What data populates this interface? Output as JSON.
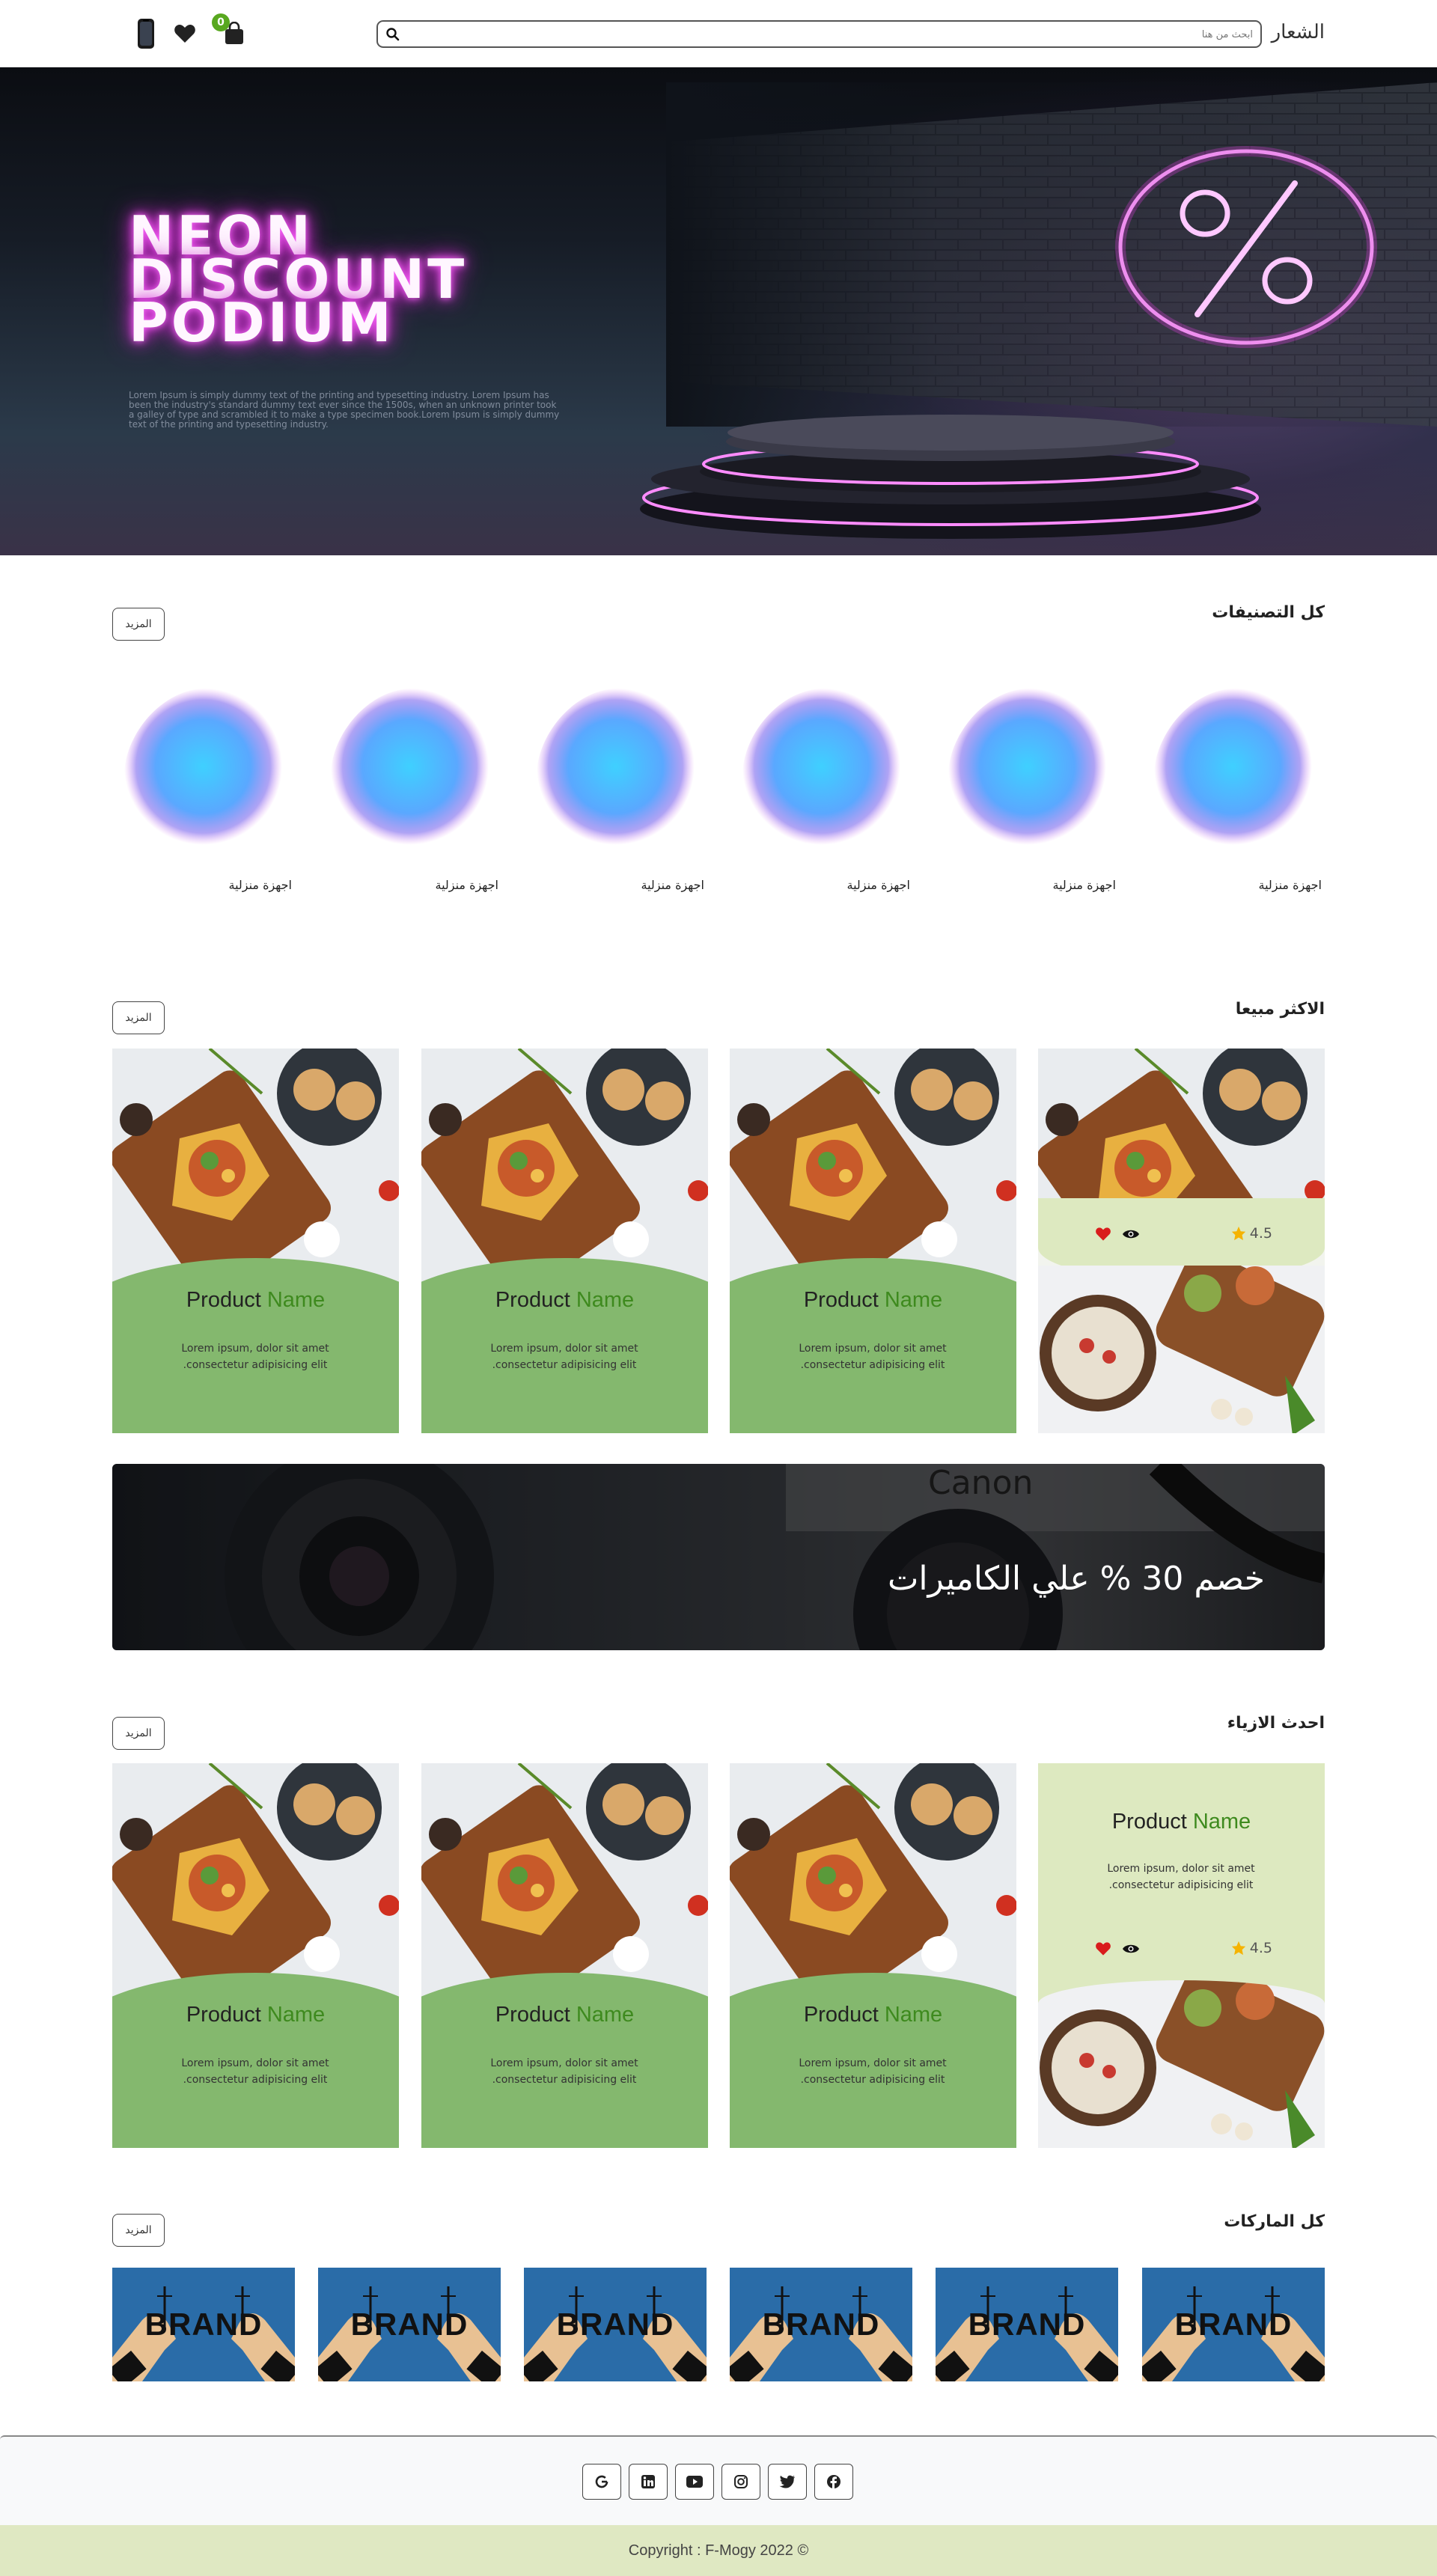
{
  "navbar": {
    "brand": "الشعار",
    "search_placeholder": "ابحث من هنا",
    "cart_count": "0"
  },
  "hero": {
    "title": "NEON\nDISCOUNT\nPODIUM",
    "subtitle": "Lorem Ipsum is simply dummy text of the printing and typesetting industry. Lorem Ipsum has been the industry's standard dummy text ever since the 1500s, when an unknown printer took a galley of type and scrambled it to make a type specimen book.Lorem Ipsum is simply dummy text of the printing and typesetting industry."
  },
  "categories": {
    "title": "كل التصنيفات",
    "more": "المزيد",
    "items": [
      {
        "label": "اجهزة منزلية"
      },
      {
        "label": "اجهزة منزلية"
      },
      {
        "label": "اجهزة منزلية"
      },
      {
        "label": "اجهزة منزلية"
      },
      {
        "label": "اجهزة منزلية"
      },
      {
        "label": "اجهزة منزلية"
      }
    ]
  },
  "bestsellers": {
    "title": "الاكثر مبيعا",
    "more": "المزيد",
    "hover_rating": "4.5",
    "cards": [
      {
        "name_a": "Product",
        "name_b": "Name",
        "desc": "Lorem ipsum, dolor sit amet consectetur adipisicing elit."
      },
      {
        "name_a": "Product",
        "name_b": "Name",
        "desc": "Lorem ipsum, dolor sit amet consectetur adipisicing elit."
      },
      {
        "name_a": "Product",
        "name_b": "Name",
        "desc": "Lorem ipsum, dolor sit amet consectetur adipisicing elit."
      }
    ]
  },
  "promo": {
    "text": "خصم 30 % علي الكاميرات"
  },
  "fashion": {
    "title": "احدث الازياء",
    "more": "المزيد",
    "hover_name_a": "Product",
    "hover_name_b": "Name",
    "hover_desc": "Lorem ipsum, dolor sit amet consectetur adipisicing elit.",
    "hover_rating": "4.5",
    "cards": [
      {
        "name_a": "Product",
        "name_b": "Name",
        "desc": "Lorem ipsum, dolor sit amet consectetur adipisicing elit."
      },
      {
        "name_a": "Product",
        "name_b": "Name",
        "desc": "Lorem ipsum, dolor sit amet consectetur adipisicing elit."
      },
      {
        "name_a": "Product",
        "name_b": "Name",
        "desc": "Lorem ipsum, dolor sit amet consectetur adipisicing elit."
      }
    ]
  },
  "brands": {
    "title": "كل الماركات",
    "more": "المزيد",
    "logo_text": "BRAND"
  },
  "footer": {
    "socials": [
      "google-icon",
      "linkedin-icon",
      "youtube-icon",
      "instagram-icon",
      "twitter-icon",
      "facebook-icon"
    ],
    "copyright": "Copyright : F-Mogy 2022 ©"
  },
  "colors": {
    "accent_green": "#84b86e",
    "pale_green": "#dfe8c2",
    "badge_green": "#58a81f",
    "neon_pink": "#e030e0"
  }
}
